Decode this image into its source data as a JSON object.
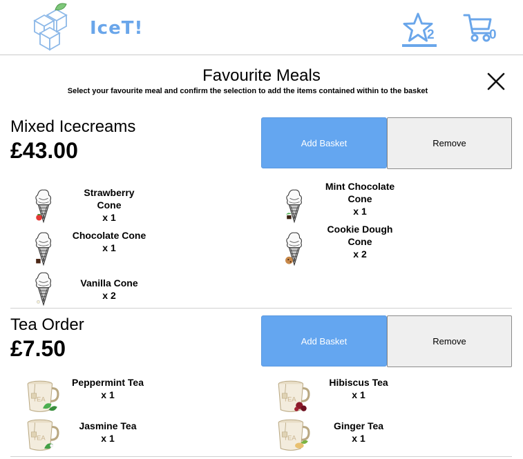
{
  "header": {
    "logo_text": "IceT!",
    "favourites_count": "2",
    "basket_count": "0",
    "accent_color": "#6aa6ea"
  },
  "page": {
    "title": "Favourite Meals",
    "subtitle": "Select your favourite meal and confirm the selection to add the items contained within to the basket"
  },
  "meals": [
    {
      "name": "Mixed Icecreams",
      "price": "£43.00",
      "add_label": "Add Basket",
      "remove_label": "Remove",
      "items": [
        {
          "name": "Strawberry Cone",
          "qty": "x 1",
          "icon": "strawberry-cone-icon"
        },
        {
          "name": "Mint Chocolate Cone",
          "qty": "x 1",
          "icon": "mint-chocolate-cone-icon"
        },
        {
          "name": "Chocolate Cone",
          "qty": "x 1",
          "icon": "chocolate-cone-icon"
        },
        {
          "name": "Cookie Dough Cone",
          "qty": "x 2",
          "icon": "cookie-dough-cone-icon"
        },
        {
          "name": "Vanilla Cone",
          "qty": "x 2",
          "icon": "vanilla-cone-icon"
        }
      ]
    },
    {
      "name": "Tea Order",
      "price": "£7.50",
      "add_label": "Add Basket",
      "remove_label": "Remove",
      "items": [
        {
          "name": "Peppermint Tea",
          "qty": "x 1",
          "icon": "peppermint-tea-icon"
        },
        {
          "name": "Hibiscus Tea",
          "qty": "x 1",
          "icon": "hibiscus-tea-icon"
        },
        {
          "name": "Jasmine Tea",
          "qty": "x 1",
          "icon": "jasmine-tea-icon"
        },
        {
          "name": "Ginger Tea",
          "qty": "x 1",
          "icon": "ginger-tea-icon"
        }
      ]
    }
  ]
}
